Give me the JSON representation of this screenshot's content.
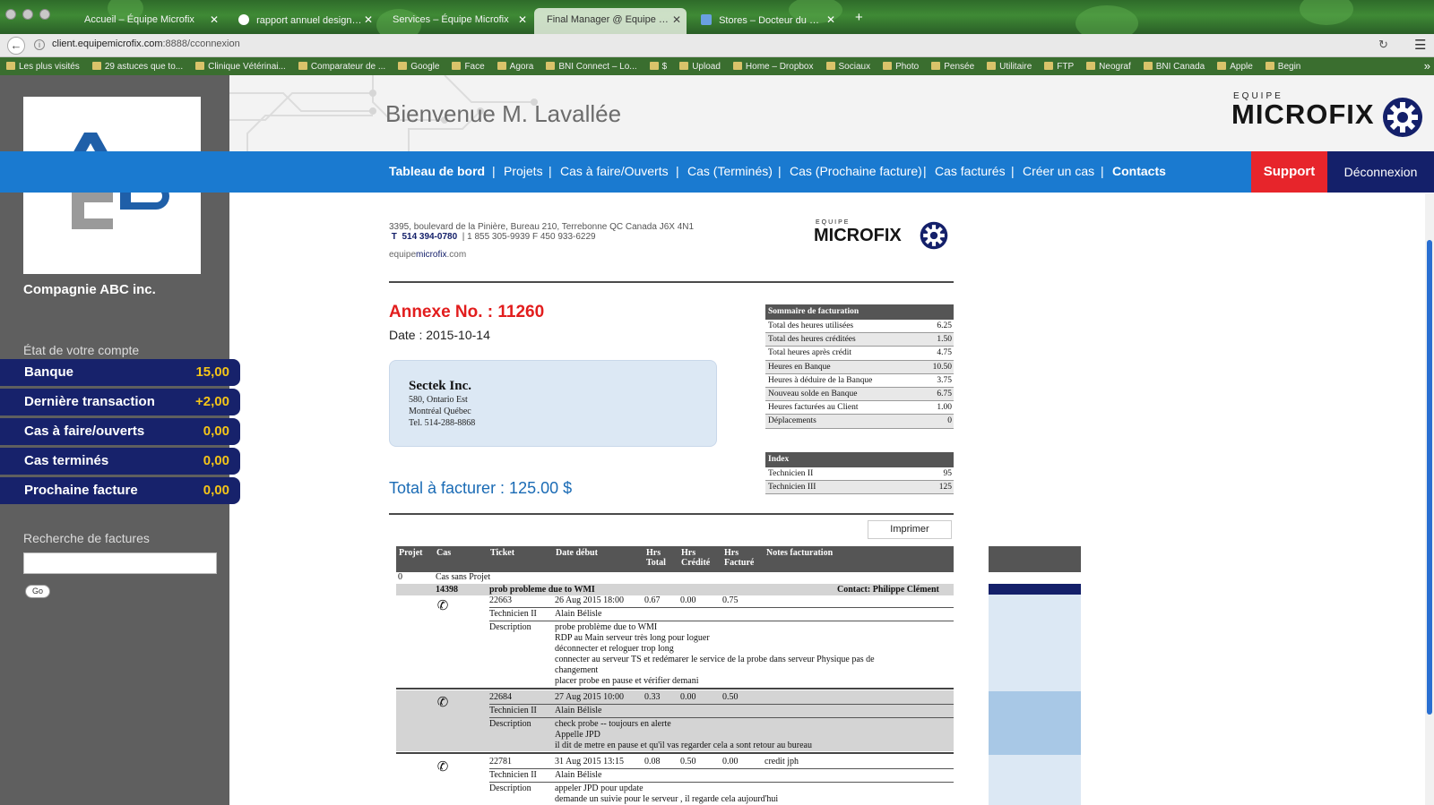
{
  "browser": {
    "tabs": [
      {
        "label": "Accueil – Équipe Microfix"
      },
      {
        "label": "rapport annuel design – R..."
      },
      {
        "label": "Services – Équipe Microfix"
      },
      {
        "label": "Final Manager @ Equipe Microfix"
      },
      {
        "label": "Stores – Docteur du Pare..."
      }
    ],
    "close_glyph": "✕",
    "new_tab_glyph": "+",
    "url_host": "client.equipemicrofix.com",
    "url_rest": ":8888/cconnexion",
    "bookmarks": [
      "Les plus visités",
      "29 astuces que to...",
      "Clinique Vétérinai...",
      "Comparateur de ...",
      "Google",
      "Face",
      "Agora",
      "BNI Connect – Lo...",
      "$",
      "Upload",
      "Home – Dropbox",
      "Sociaux",
      "Photo",
      "Pensée",
      "Utilitaire",
      "FTP",
      "Neograf",
      "BNI Canada",
      "Apple",
      "Begin"
    ],
    "bookmarks_more": "»"
  },
  "sidebar": {
    "company_name": "Compagnie ABC inc.",
    "account_heading": "État de votre compte",
    "stats": [
      {
        "label": "Banque",
        "value": "15,00"
      },
      {
        "label": "Dernière transaction",
        "value": "+2,00"
      },
      {
        "label": "Cas à faire/ouverts",
        "value": "0,00"
      },
      {
        "label": "Cas terminés",
        "value": "0,00"
      },
      {
        "label": "Prochaine facture",
        "value": "0,00"
      }
    ],
    "search_heading": "Recherche de factures",
    "search_value": "",
    "go_label": "Go"
  },
  "header": {
    "welcome": "Bienvenue M. Lavallée",
    "brand_top": "EQUIPE",
    "brand": "MICROFIX"
  },
  "nav": {
    "items": [
      "Tableau de bord",
      "Projets",
      "Cas à faire/Ouverts",
      "Cas (Terminés)",
      "Cas (Prochaine facture)",
      "Cas facturés",
      "Créer un cas",
      "Contacts"
    ],
    "separator": "|",
    "support": "Support",
    "logout": "Déconnexion"
  },
  "document": {
    "address": "3395, boulevard de la Pinière, Bureau 210, Terrebonne  QC  Canada  J6X 4N1",
    "phone_t_label": "T",
    "phone_t": "514 394-0780",
    "phone_rest": "|  1 855 305-9939   F   450 933-6229",
    "web_pre": "equipe",
    "web_bold": "microfix",
    "web_post": ".com",
    "brand_top": "EQUIPE",
    "brand": "MICROFIX",
    "annexe": "Annexe No. : 11260",
    "date": "Date : 2015-10-14",
    "client": {
      "name": "Sectek Inc.",
      "lines": [
        "580, Ontario Est",
        "Montréal Québec",
        "Tel. 514-288-8868"
      ]
    },
    "total": "Total à facturer : 125.00 $",
    "summary": {
      "title": "Sommaire de facturation",
      "rows": [
        {
          "label": "Total des heures utilisées",
          "value": "6.25"
        },
        {
          "label": "Total des heures créditées",
          "value": "1.50"
        },
        {
          "label": "Total heures après crédit",
          "value": "4.75"
        },
        {
          "label": "Heures en Banque",
          "value": "10.50"
        },
        {
          "label": "Heures à déduire de la Banque",
          "value": "3.75"
        },
        {
          "label": "Nouveau solde en Banque",
          "value": "6.75"
        },
        {
          "label": "Heures facturées au Client",
          "value": "1.00"
        },
        {
          "label": "Déplacements",
          "value": "0"
        }
      ]
    },
    "index": {
      "title": "Index",
      "rows": [
        {
          "label": "Technicien II",
          "value": "95"
        },
        {
          "label": "Technicien III",
          "value": "125"
        }
      ]
    },
    "print_label": "Imprimer",
    "grid": {
      "headers": {
        "projet": "Projet",
        "cas": "Cas",
        "ticket": "Ticket",
        "date": "Date début",
        "hrs_total": "Hrs\nTotal",
        "hrs_credit": "Hrs\nCrédité",
        "hrs_facture": "Hrs\nFacturé",
        "notes": "Notes facturation"
      },
      "project_id": "0",
      "project_name": "Cas sans Projet",
      "case_id": "14398",
      "case_title": "prob probleme due to WMI",
      "case_contact": "Contact: Philippe Clément",
      "tech_label": "Technicien II",
      "tech_name": "Alain Bélisle",
      "desc_label": "Description",
      "tickets": [
        {
          "id": "22663",
          "date": "26 Aug 2015 18:00",
          "total": "0.67",
          "credit": "0.00",
          "facture": "0.75",
          "note": "",
          "desc": [
            "probe problème due to WMI",
            "RDP au Main serveur très long pour loguer",
            "déconnecter et reloguer trop long",
            "connecter au serveur TS et redémarer le service de la probe dans serveur Physique pas de",
            "changement",
            "placer probe en pause et vérifier demani"
          ]
        },
        {
          "id": "22684",
          "date": "27 Aug 2015 10:00",
          "total": "0.33",
          "credit": "0.00",
          "facture": "0.50",
          "note": "",
          "desc": [
            "check probe -- toujours en alerte",
            "Appelle JPD",
            "il dit de metre en pause et qu'il vas regarder cela a sont retour au bureau"
          ]
        },
        {
          "id": "22781",
          "date": "31 Aug 2015 13:15",
          "total": "0.08",
          "credit": "0.50",
          "facture": "0.00",
          "note": "credit jph",
          "desc": [
            "appeler JPD pour update",
            "demande un suivie pour le serveur , il regarde cela aujourd'hui"
          ]
        }
      ]
    }
  },
  "colors": {
    "nav_blue": "#1a7ad0",
    "dark_navy": "#14206a",
    "support_red": "#e7252b",
    "annexe_red": "#e21d1d",
    "stat_value_yellow": "#f5c518",
    "sidebar_gray": "#5f5f5f"
  },
  "icons": {
    "back": "arrow-left-icon",
    "reload": "reload-icon",
    "menu": "hamburger-menu-icon",
    "phone": "phone-icon",
    "gear": "gear-icon"
  }
}
